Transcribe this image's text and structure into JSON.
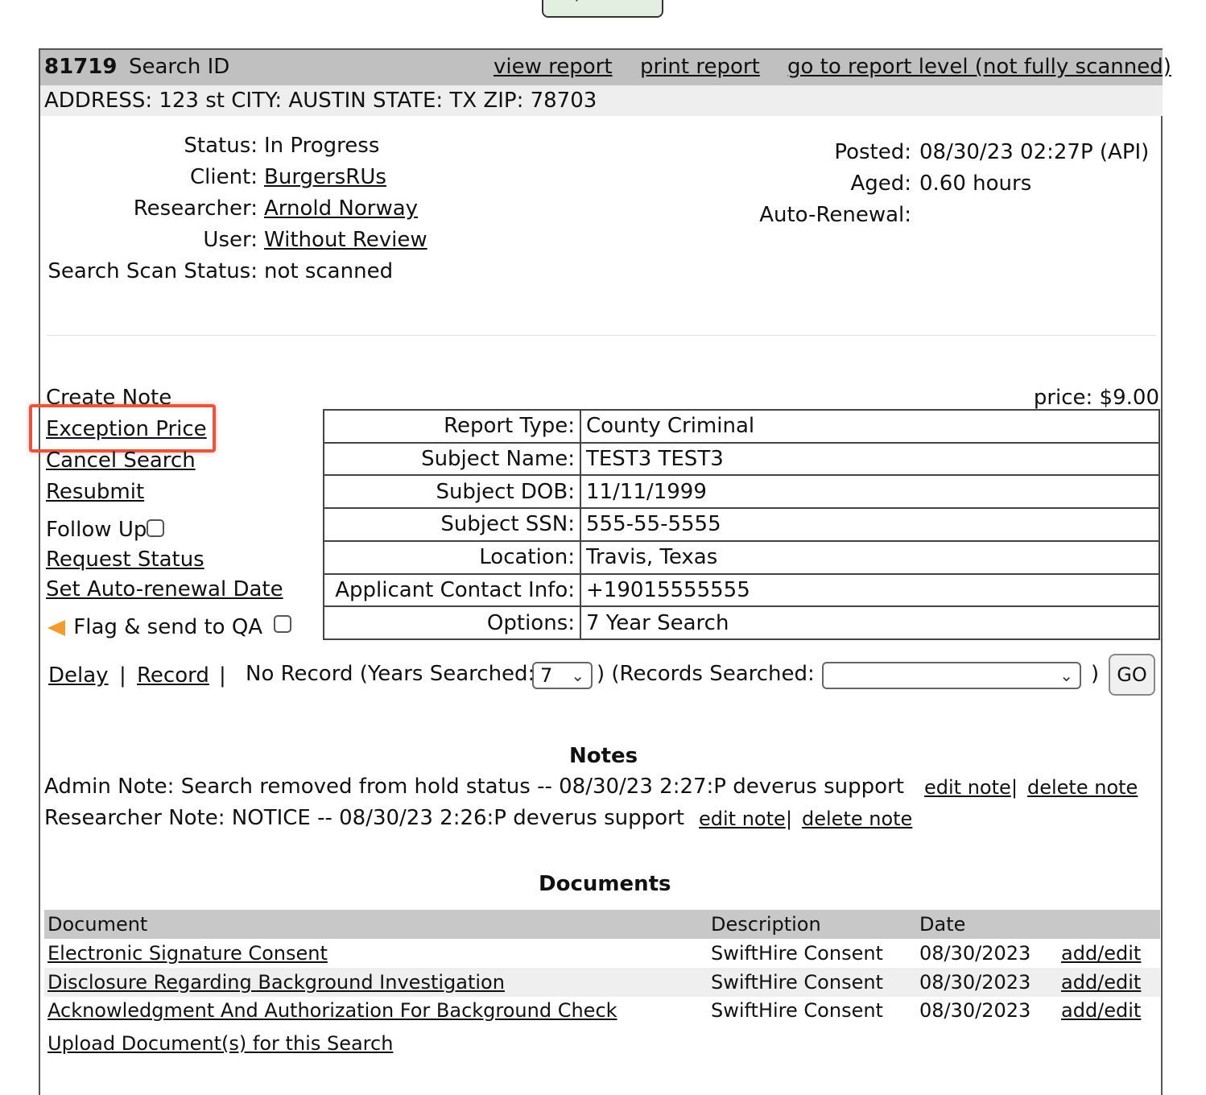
{
  "top_button": {
    "label": "Rapid Clear"
  },
  "header": {
    "search_id": "81719",
    "search_id_label": "Search ID",
    "view_report": "view report",
    "print_report": "print report",
    "report_level": "go to report level (not fully scanned)",
    "address": "ADDRESS: 123 st CITY: AUSTIN STATE: TX ZIP: 78703"
  },
  "info": {
    "status_label": "Status:",
    "status": "In Progress",
    "client_label": "Client:",
    "client": "BurgersRUs",
    "researcher_label": "Researcher:",
    "researcher": "Arnold Norway",
    "user_label": "User:",
    "user": "Without Review",
    "scan_label": "Search Scan Status:",
    "scan": "not scanned",
    "posted_label": "Posted:",
    "posted": "08/30/23 02:27P (API)",
    "aged_label": "Aged:",
    "aged": "0.60 hours",
    "autorenew_label": "Auto-Renewal:",
    "autorenew": ""
  },
  "actions": {
    "create_note": "Create Note",
    "exception_price": "Exception Price",
    "cancel_search": "Cancel Search",
    "resubmit": "Resubmit",
    "follow_up": "Follow Up",
    "request_status": "Request Status",
    "set_autorenew": "Set Auto-renewal Date",
    "flag_qa": "Flag & send to QA"
  },
  "price": "price: $9.00",
  "details": [
    {
      "key": "Report Type:",
      "value": "County Criminal"
    },
    {
      "key": "Subject Name:",
      "value": "TEST3 TEST3"
    },
    {
      "key": "Subject DOB:",
      "value": "11/11/1999"
    },
    {
      "key": "Subject SSN:",
      "value": "555-55-5555"
    },
    {
      "key": "Location:",
      "value": "Travis, Texas"
    },
    {
      "key": "Applicant Contact Info:",
      "value": "+19015555555"
    },
    {
      "key": "Options:",
      "value": "7 Year Search"
    }
  ],
  "result_bar": {
    "delay": "Delay",
    "sep": "|",
    "record": "Record",
    "no_record_prefix": "No Record (Years Searched:",
    "years_value": "7",
    "records_label": ") (Records Searched:",
    "records_value": "",
    "close_paren": ")",
    "go": "GO"
  },
  "notes": {
    "title": "Notes",
    "items": [
      {
        "text": "Admin Note: Search removed from hold status -- 08/30/23 2:27:P deverus support",
        "edit": "edit note",
        "delete": "delete note"
      },
      {
        "text": "Researcher Note: NOTICE -- 08/30/23 2:26:P deverus support",
        "edit": "edit note",
        "delete": "delete note"
      }
    ]
  },
  "documents": {
    "title": "Documents",
    "columns": [
      "Document",
      "Description",
      "Date"
    ],
    "rows": [
      {
        "name": "Electronic Signature Consent",
        "description": "SwiftHire Consent",
        "date": "08/30/2023",
        "action": "add/edit"
      },
      {
        "name": "Disclosure Regarding Background Investigation",
        "description": "SwiftHire Consent",
        "date": "08/30/2023",
        "action": "add/edit"
      },
      {
        "name": "Acknowledgment And Authorization For Background Check",
        "description": "SwiftHire Consent",
        "date": "08/30/2023",
        "action": "add/edit"
      }
    ],
    "upload": "Upload Document(s) for this Search"
  },
  "colors": {
    "highlight": "#e8553f",
    "header_bg": "#c0c0c0",
    "flag_icon": "#f39b2c"
  }
}
